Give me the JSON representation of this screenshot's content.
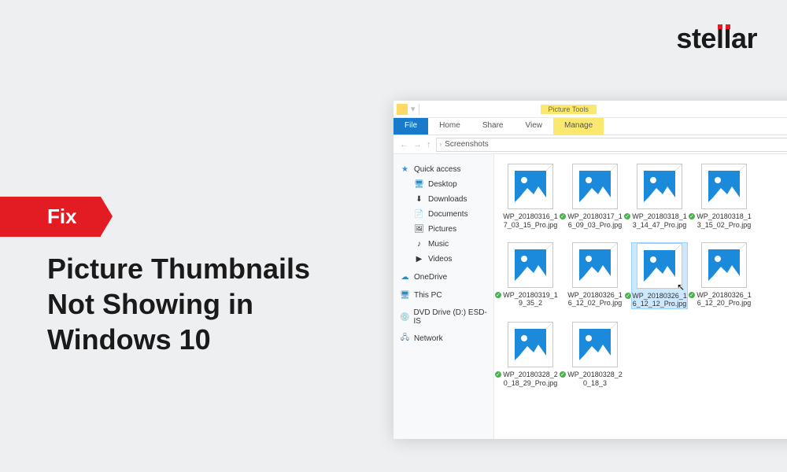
{
  "logo": "stellar",
  "badge": "Fix",
  "headline": "Picture Thumbnails Not Showing in Windows 10",
  "titlebar": {
    "picture_tools": "Picture Tools"
  },
  "tabs": {
    "file": "File",
    "home": "Home",
    "share": "Share",
    "view": "View",
    "manage": "Manage"
  },
  "address": {
    "folder": "Screenshots"
  },
  "sidebar": {
    "quick_access": "Quick access",
    "desktop": "Desktop",
    "downloads": "Downloads",
    "documents": "Documents",
    "pictures": "Pictures",
    "music": "Music",
    "videos": "Videos",
    "onedrive": "OneDrive",
    "this_pc": "This PC",
    "dvd": "DVD Drive (D:) ESD-IS",
    "network": "Network"
  },
  "files": [
    {
      "name": "WP_20180316_17_03_15_Pro.jpg",
      "synced": false,
      "selected": false
    },
    {
      "name": "WP_20180317_16_09_03_Pro.jpg",
      "synced": true,
      "selected": false
    },
    {
      "name": "WP_20180318_13_14_47_Pro.jpg",
      "synced": true,
      "selected": false
    },
    {
      "name": "WP_20180318_13_15_02_Pro.jpg",
      "synced": true,
      "selected": false
    },
    {
      "name": "WP_20180319_19_35_2",
      "synced": true,
      "selected": false
    },
    {
      "name": "WP_20180326_16_12_02_Pro.jpg",
      "synced": false,
      "selected": false
    },
    {
      "name": "WP_20180326_16_12_12_Pro.jpg",
      "synced": true,
      "selected": true
    },
    {
      "name": "WP_20180326_16_12_20_Pro.jpg",
      "synced": true,
      "selected": false
    },
    {
      "name": "WP_20180328_20_18_29_Pro.jpg",
      "synced": true,
      "selected": false
    },
    {
      "name": "WP_20180328_20_18_3",
      "synced": true,
      "selected": false
    }
  ]
}
